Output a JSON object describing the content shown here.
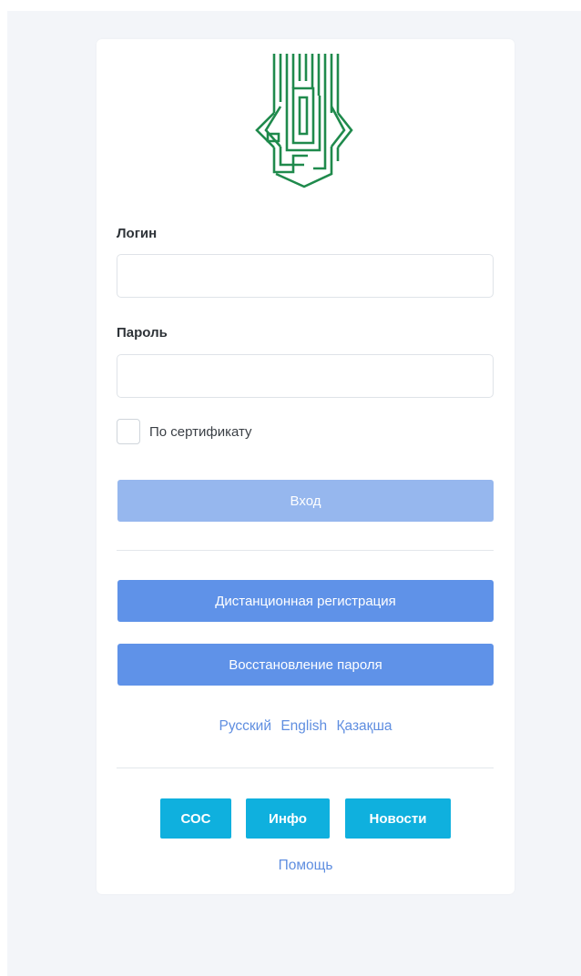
{
  "login_form": {
    "login_label": "Логин",
    "login_value": "",
    "login_placeholder": "",
    "password_label": "Пароль",
    "password_value": "",
    "password_placeholder": "",
    "certificate_checkbox_label": "По сертификату",
    "certificate_checked": false,
    "submit_label": "Вход"
  },
  "actions": {
    "remote_registration_label": "Дистанционная регистрация",
    "password_recovery_label": "Восстановление пароля"
  },
  "languages": [
    "Русский",
    "English",
    "Қазақша"
  ],
  "footer": {
    "sos_label": "СОС",
    "info_label": "Инфо",
    "news_label": "Новости",
    "help_label": "Помощь"
  },
  "colors": {
    "page_background": "#f3f5f9",
    "logo_green": "#1f8a4c",
    "login_button": "#96b7ee",
    "primary_button": "#5f92e8",
    "link": "#5f8ee0",
    "footer_button": "#0fb0de"
  },
  "icons": {
    "logo": "green-maze-arrow-logo"
  }
}
